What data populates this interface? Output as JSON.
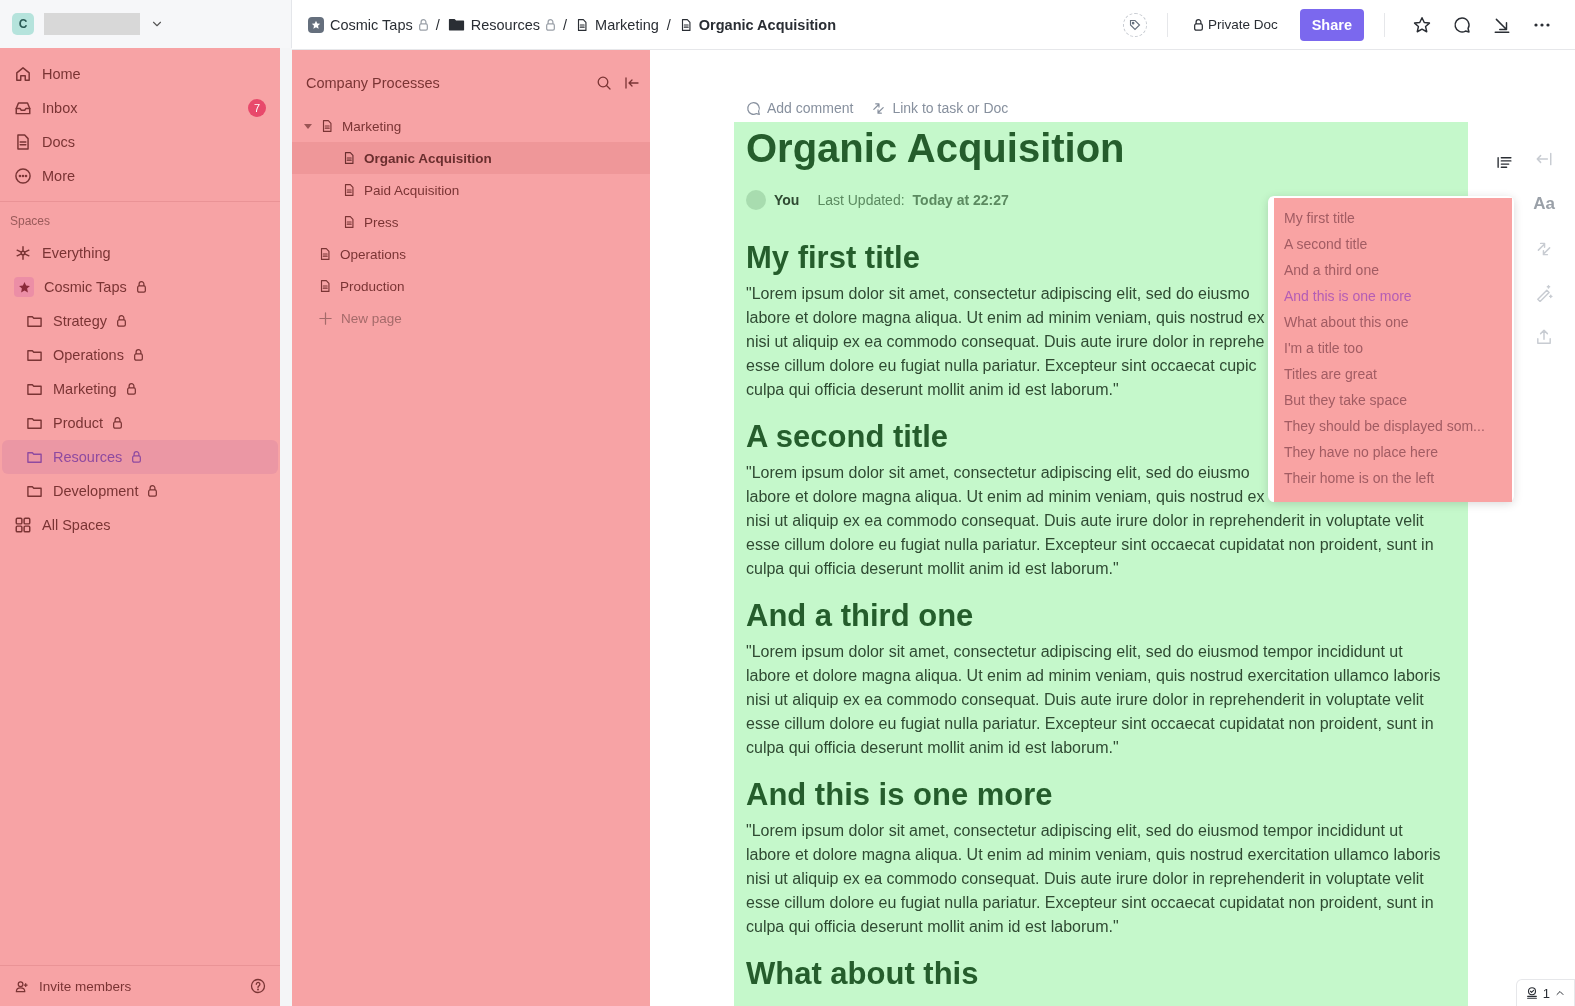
{
  "workspace": {
    "initial": "C"
  },
  "sidebar": {
    "nav": [
      {
        "label": "Home"
      },
      {
        "label": "Inbox",
        "badge": "7"
      },
      {
        "label": "Docs"
      },
      {
        "label": "More"
      }
    ],
    "spaces_label": "Spaces",
    "everything": "Everything",
    "space": {
      "label": "Cosmic Taps",
      "locked": true
    },
    "folders": [
      {
        "label": "Strategy",
        "locked": true,
        "selected": false
      },
      {
        "label": "Operations",
        "locked": true,
        "selected": false
      },
      {
        "label": "Marketing",
        "locked": true,
        "selected": false
      },
      {
        "label": "Product",
        "locked": true,
        "selected": false
      },
      {
        "label": "Resources",
        "locked": true,
        "selected": true
      },
      {
        "label": "Development",
        "locked": true,
        "selected": false
      }
    ],
    "all_spaces": "All Spaces",
    "invite": "Invite members"
  },
  "breadcrumb": [
    {
      "label": "Cosmic Taps",
      "kind": "space",
      "locked": true
    },
    {
      "separator": "/",
      "label": "Resources",
      "kind": "folder",
      "locked": true
    },
    {
      "separator": "/",
      "label": "Marketing",
      "kind": "doc"
    },
    {
      "separator": "/",
      "label": "Organic Acquisition",
      "kind": "doc"
    }
  ],
  "toolbar": {
    "privacy": "Private Doc",
    "share": "Share"
  },
  "panel": {
    "title": "Company Processes",
    "tree": [
      {
        "label": "Marketing",
        "expanded": true,
        "selected": false,
        "children": [
          {
            "label": "Organic Acquisition",
            "selected": true
          },
          {
            "label": "Paid Acquisition",
            "selected": false
          },
          {
            "label": "Press",
            "selected": false
          }
        ]
      },
      {
        "label": "Operations",
        "expanded": false,
        "selected": false
      },
      {
        "label": "Production",
        "expanded": false,
        "selected": false
      }
    ],
    "new_page": "New page"
  },
  "doc": {
    "actions": [
      "Add comment",
      "Link to task or Doc"
    ],
    "title": "Organic Acquisition",
    "author": "You",
    "updated_label": "Last Updated:",
    "updated": "Today at 22:27",
    "sections": [
      {
        "heading": "My first title",
        "lines": [
          "\"Lorem ipsum dolor sit amet, consectetur adipiscing elit, sed do eiusmo",
          "labore et dolore magna aliqua. Ut enim ad minim veniam, quis nostrud ex",
          "nisi ut aliquip ex ea commodo consequat. Duis aute irure dolor in reprehe",
          "esse cillum dolore eu fugiat nulla pariatur. Excepteur sint occaecat cupic",
          "culpa qui officia deserunt mollit anim id est laborum.\""
        ]
      },
      {
        "heading": "A second title",
        "lines": [
          "\"Lorem ipsum dolor sit amet, consectetur adipiscing elit, sed do eiusmo",
          "labore et dolore magna aliqua. Ut enim ad minim veniam, quis nostrud ex",
          "nisi ut aliquip ex ea commodo consequat. Duis aute irure dolor in reprehenderit in voluptate velit",
          "esse cillum dolore eu fugiat nulla pariatur. Excepteur sint occaecat cupidatat non proident, sunt in",
          "culpa qui officia deserunt mollit anim id est laborum.\""
        ]
      },
      {
        "heading": "And a third one",
        "lines": [
          "\"Lorem ipsum dolor sit amet, consectetur adipiscing elit, sed do eiusmod tempor incididunt ut",
          "labore et dolore magna aliqua. Ut enim ad minim veniam, quis nostrud exercitation ullamco laboris",
          "nisi ut aliquip ex ea commodo consequat. Duis aute irure dolor in reprehenderit in voluptate velit",
          "esse cillum dolore eu fugiat nulla pariatur. Excepteur sint occaecat cupidatat non proident, sunt in",
          "culpa qui officia deserunt mollit anim id est laborum.\""
        ]
      },
      {
        "heading": "And this is one more",
        "lines": [
          "\"Lorem ipsum dolor sit amet, consectetur adipiscing elit, sed do eiusmod tempor incididunt ut",
          "labore et dolore magna aliqua. Ut enim ad minim veniam, quis nostrud exercitation ullamco laboris",
          "nisi ut aliquip ex ea commodo consequat. Duis aute irure dolor in reprehenderit in voluptate velit",
          "esse cillum dolore eu fugiat nulla pariatur. Excepteur sint occaecat cupidatat non proident, sunt in",
          "culpa qui officia deserunt mollit anim id est laborum.\""
        ]
      },
      {
        "heading": "What about this"
      }
    ]
  },
  "outline": [
    {
      "label": "My first title",
      "selected": false
    },
    {
      "label": "A second title",
      "selected": false
    },
    {
      "label": "And a third one",
      "selected": false
    },
    {
      "label": "And this is one more",
      "selected": true
    },
    {
      "label": "What about this one",
      "selected": false
    },
    {
      "label": "I'm a title too",
      "selected": false
    },
    {
      "label": "Titles are great",
      "selected": false
    },
    {
      "label": "But they take space",
      "selected": false
    },
    {
      "label": "They should be displayed som...",
      "selected": false
    },
    {
      "label": "They have no place here",
      "selected": false
    },
    {
      "label": "Their home is on the left",
      "selected": false
    }
  ],
  "side_tools": {
    "font": "Aa"
  },
  "tasks_widget": {
    "count": "1"
  }
}
